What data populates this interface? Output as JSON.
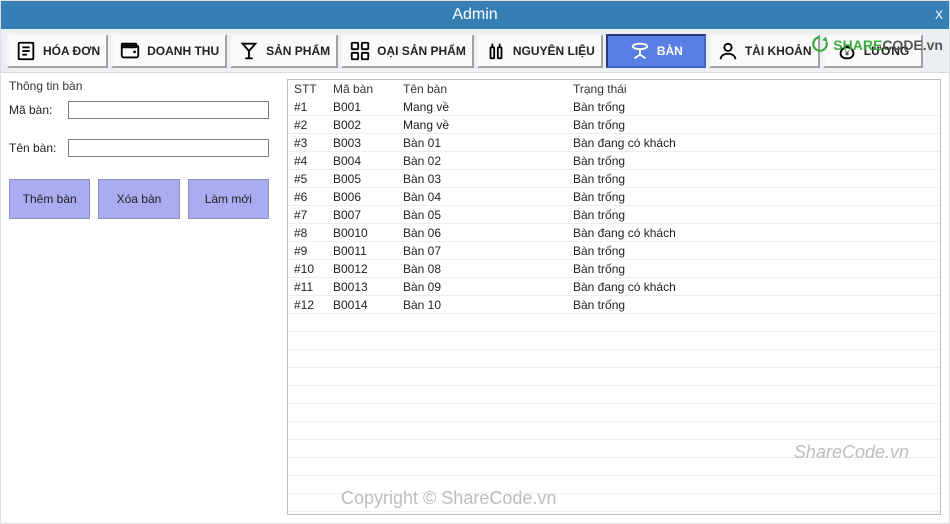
{
  "title": "Admin",
  "close_glyph": "X",
  "brand": {
    "prefix": "SHARE",
    "suffix": "CODE.vn"
  },
  "toolbar": [
    {
      "key": "hoa-don",
      "label": "HÓA ĐƠN",
      "icon": "receipt",
      "active": false
    },
    {
      "key": "doanh-thu",
      "label": "DOANH THU",
      "icon": "wallet",
      "active": false
    },
    {
      "key": "san-pham",
      "label": "SẢN PHẨM",
      "icon": "cocktail",
      "active": false
    },
    {
      "key": "loai-san-pham",
      "label": "OẠI SẢN PHẨM",
      "icon": "grid",
      "active": false
    },
    {
      "key": "nguyen-lieu",
      "label": "NGUYÊN LIỆU",
      "icon": "bottles",
      "active": false
    },
    {
      "key": "ban",
      "label": "BÀN",
      "icon": "table-furniture",
      "active": true
    },
    {
      "key": "tai-khoan",
      "label": "TÀI KHOẢN",
      "icon": "user",
      "active": false
    },
    {
      "key": "luong",
      "label": "LƯƠNG",
      "icon": "money-bag",
      "active": false
    }
  ],
  "form": {
    "group_title": "Thông tin bàn",
    "ma_ban_label": "Mã bàn:",
    "ten_ban_label": "Tên bàn:",
    "ma_ban_value": "",
    "ten_ban_value": "",
    "btn_add": "Thêm bàn",
    "btn_delete": "Xóa bàn",
    "btn_refresh": "Làm mới"
  },
  "table": {
    "headers": {
      "stt": "STT",
      "ma": "Mã bàn",
      "ten": "Tên bàn",
      "tt": "Trạng thái"
    },
    "rows": [
      {
        "stt": "#1",
        "ma": "B001",
        "ten": "Mang về",
        "tt": "Bàn trống"
      },
      {
        "stt": "#2",
        "ma": "B002",
        "ten": "Mang về",
        "tt": "Bàn trống"
      },
      {
        "stt": "#3",
        "ma": "B003",
        "ten": "Bàn 01",
        "tt": "Bàn đang có khách"
      },
      {
        "stt": "#4",
        "ma": "B004",
        "ten": "Bàn 02",
        "tt": "Bàn trống"
      },
      {
        "stt": "#5",
        "ma": "B005",
        "ten": "Bàn 03",
        "tt": "Bàn trống"
      },
      {
        "stt": "#6",
        "ma": "B006",
        "ten": "Bàn 04",
        "tt": "Bàn trống"
      },
      {
        "stt": "#7",
        "ma": "B007",
        "ten": "Bàn 05",
        "tt": "Bàn trống"
      },
      {
        "stt": "#8",
        "ma": "B0010",
        "ten": "Bàn 06",
        "tt": "Bàn đang có khách"
      },
      {
        "stt": "#9",
        "ma": "B0011",
        "ten": "Bàn 07",
        "tt": "Bàn trống"
      },
      {
        "stt": "#10",
        "ma": "B0012",
        "ten": "Bàn 08",
        "tt": "Bàn trống"
      },
      {
        "stt": "#11",
        "ma": "B0013",
        "ten": "Bàn 09",
        "tt": "Bàn đang có khách"
      },
      {
        "stt": "#12",
        "ma": "B0014",
        "ten": "Bàn 10",
        "tt": "Bàn trống"
      }
    ]
  },
  "watermark1": "ShareCode.vn",
  "watermark2": "Copyright © ShareCode.vn",
  "icons": {
    "receipt": "receipt-icon",
    "wallet": "wallet-icon",
    "cocktail": "cocktail-icon",
    "grid": "grid-icon",
    "bottles": "bottles-icon",
    "table-furniture": "table-icon",
    "user": "user-icon",
    "money-bag": "money-bag-icon",
    "spinner": "spinner-icon"
  }
}
